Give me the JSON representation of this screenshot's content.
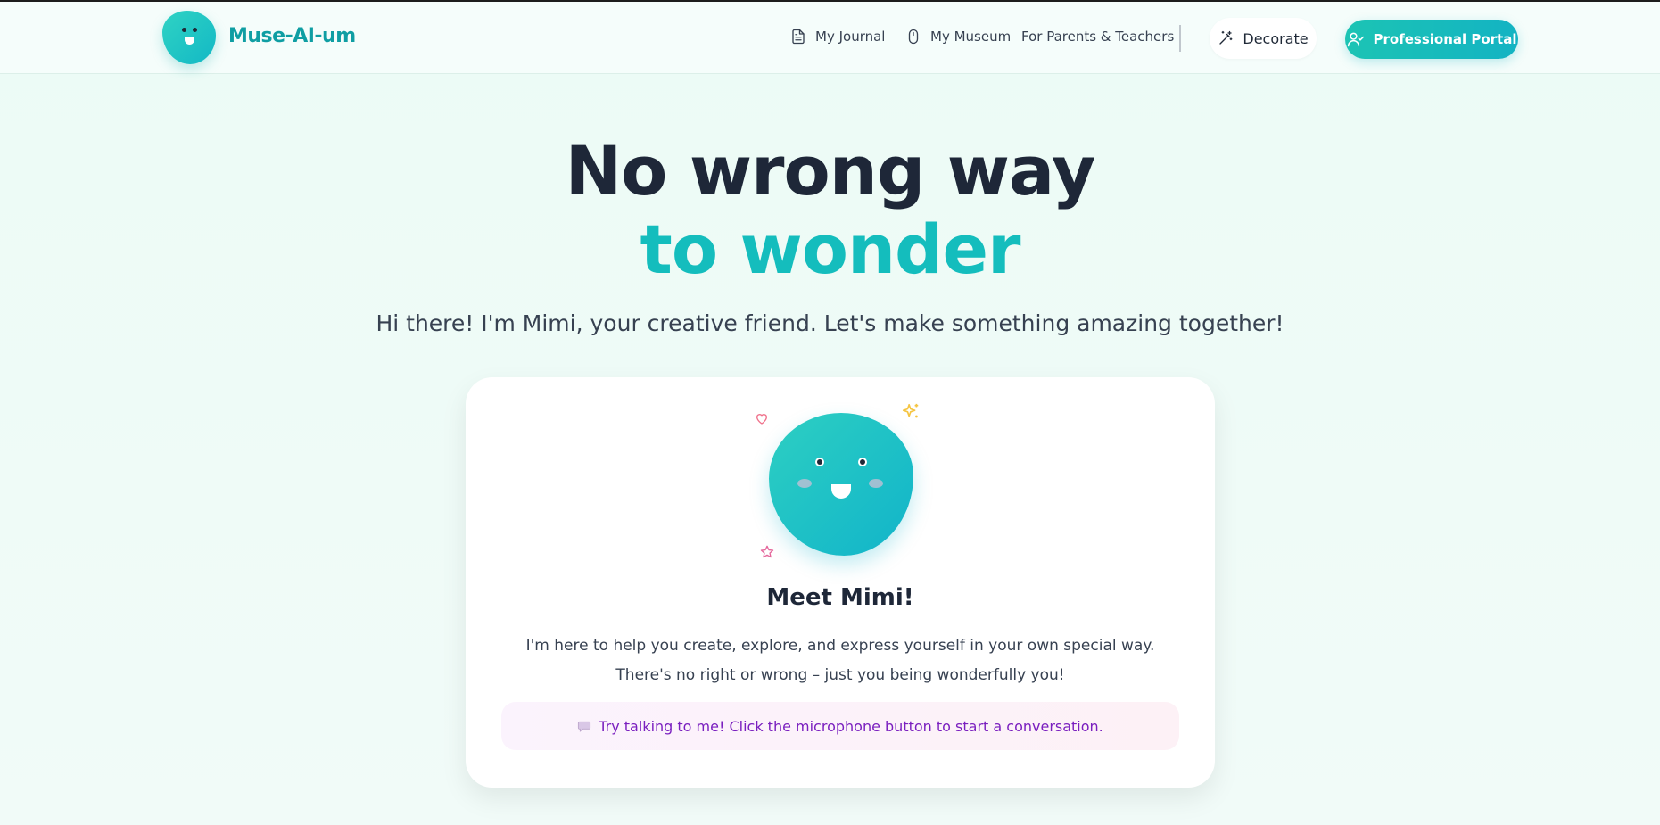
{
  "header": {
    "brand": "Muse-AI-um",
    "nav": {
      "journal": "My Journal",
      "museum": "My Museum",
      "parents": "For Parents & Teachers"
    },
    "decorate_label": "Decorate",
    "portal_label": "Professional Portal"
  },
  "hero": {
    "line1": "No wrong way",
    "line2": "to wonder",
    "subtitle": "Hi there! I'm Mimi, your creative friend. Let's make something amazing together!"
  },
  "card": {
    "title": "Meet Mimi!",
    "description": "I'm here to help you create, explore, and express yourself in your own special way. There's no right or wrong – just you being wonderfully you!",
    "tip": "Try talking to me! Click the microphone button to start a conversation."
  },
  "colors": {
    "accent": "#14bdbd",
    "brand": "#0f9ea3",
    "heading": "#1e2738",
    "tip_text": "#7a1fbf"
  },
  "icons": [
    "journal-icon",
    "museum-icon",
    "wand-icon",
    "user-check-icon",
    "heart-icon",
    "sparkle-icon",
    "star-icon",
    "speech-bubble-icon"
  ]
}
